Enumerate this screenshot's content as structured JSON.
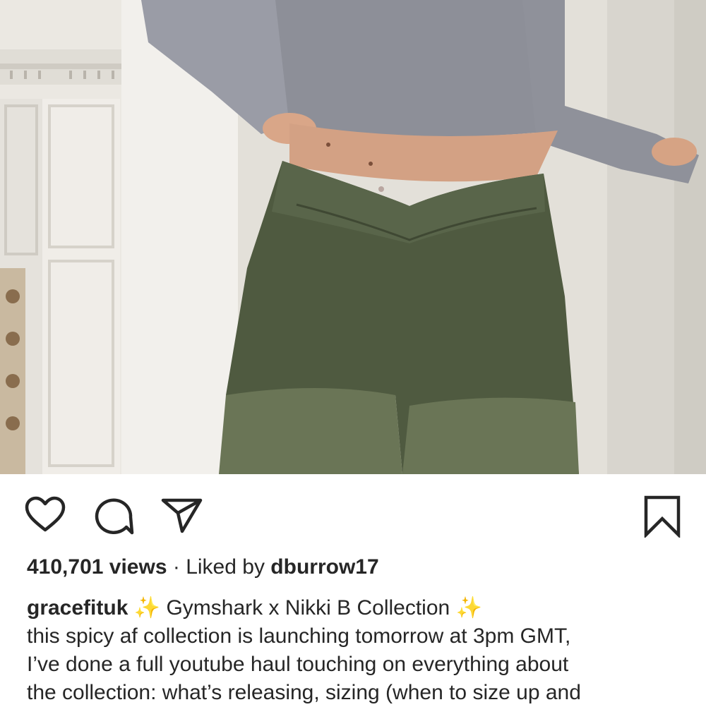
{
  "post": {
    "views": "410,701 views",
    "separator": "·",
    "liked_by_prefix": "Liked by",
    "liked_by_user": "dburrow17"
  },
  "caption": {
    "username": "gracefituk",
    "sparkle": "✨",
    "title": "Gymshark x Nikki B Collection",
    "lines": [
      "this spicy af collection is launching tomorrow at 3pm GMT,",
      "I’ve done a full youtube haul touching on everything about",
      "the collection: what’s releasing, sizing (when to size up and"
    ]
  },
  "icons": {
    "like": "heart-icon",
    "comment": "comment-icon",
    "share": "paper-plane-icon",
    "save": "bookmark-icon"
  },
  "colors": {
    "text": "#262626",
    "leggings": "#4f5a40",
    "top": "#8d8f98",
    "sparkle": "#f2c230"
  }
}
